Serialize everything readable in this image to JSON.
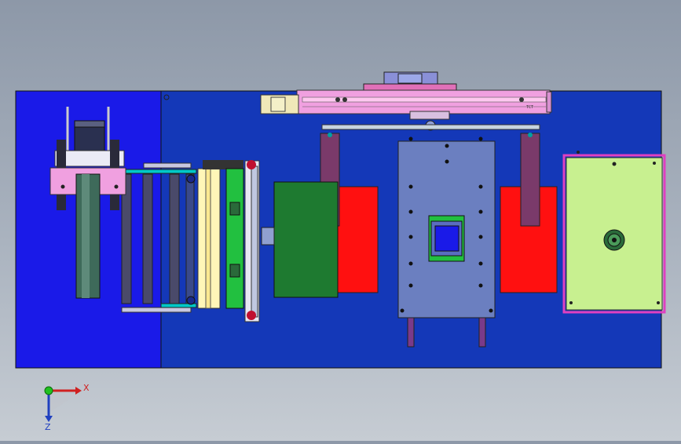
{
  "app": {
    "view": "top-view-orthographic"
  },
  "colors": {
    "background_top": "#8d98a8",
    "background_bottom": "#c6ccd3",
    "base_plate_blue": "#1438b8",
    "base_plate_bright_blue": "#1a1ae8",
    "pink_frame": "#f0a0e0",
    "red_block": "#ff1010",
    "green_block": "#1e7a30",
    "light_green_panel": "#c8f090",
    "steel_plate": "#6b7fc0",
    "purple_post": "#7a3a6a"
  },
  "icons": {
    "triad": "xyz-coordinate-triad-icon",
    "origin": "origin-sphere-icon"
  },
  "triad": {
    "x_label": "X",
    "z_label": "Z"
  },
  "stage_label": {
    "text": "TCT"
  }
}
